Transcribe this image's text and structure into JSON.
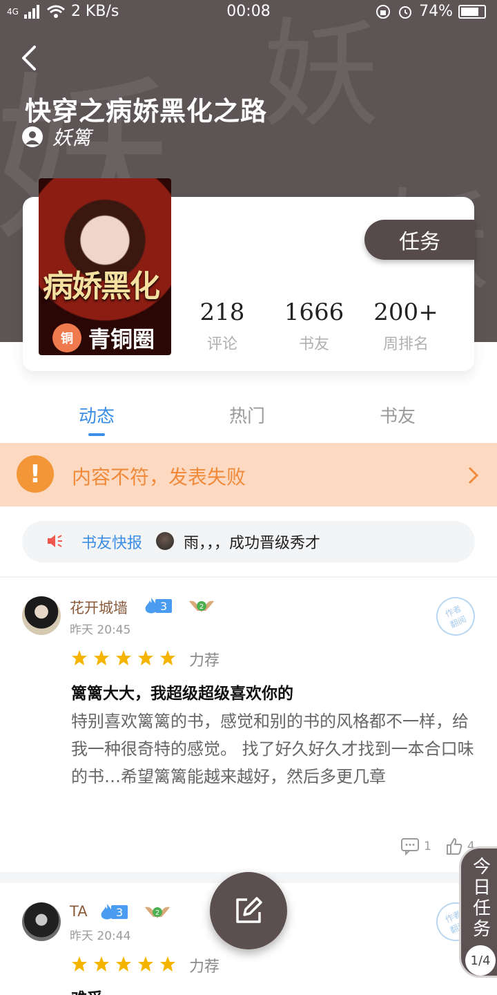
{
  "status_bar": {
    "network": "4G",
    "speed": "2 KB/s",
    "time": "00:08",
    "battery": "74%"
  },
  "header": {
    "watermark_char": "妖",
    "title": "快穿之病娇黑化之路",
    "author": "妖篱"
  },
  "cover": {
    "title_art": "病娇黑化",
    "badge_icon": "铜",
    "badge_text": "青铜圈"
  },
  "task_button": "任务",
  "stats": [
    {
      "value": "218",
      "label": "评论"
    },
    {
      "value": "1666",
      "label": "书友"
    },
    {
      "value": "200+",
      "label": "周排名"
    }
  ],
  "tabs": [
    {
      "label": "动态",
      "active": true
    },
    {
      "label": "热门",
      "active": false
    },
    {
      "label": "书友",
      "active": false
    }
  ],
  "error_banner": {
    "icon": "!",
    "text": "内容不符，发表失败"
  },
  "news": {
    "label": "书友快报",
    "text": "雨，，，成功晋级秀才"
  },
  "posts": [
    {
      "username": "花开城墙",
      "level": "3",
      "badge_level": "2",
      "time": "昨天 20:45",
      "stamp": "作者\n翻阅",
      "rating_label": "力荐",
      "stars": 5,
      "title": "篱篱大大，我超级超级喜欢你的",
      "body": "特别喜欢篱篱的书，感觉和别的书的风格都不一样，给我一种很奇特的感觉。 找了好久好久才找到一本合口味的书…希望篱篱能越来越好，然后多更几章",
      "comments": "1",
      "likes": "4"
    },
    {
      "username": "TA",
      "level": "3",
      "badge_level": "2",
      "time": "昨天 20:44",
      "stamp": "作者\n翻阅",
      "rating_label": "力荐",
      "stars": 5,
      "title": "难受"
    }
  ],
  "daily_task": {
    "label": "今日任务",
    "progress": "1/4"
  },
  "colors": {
    "header_bg": "#5d5455",
    "accent_blue": "#3a8ee6",
    "banner_bg": "#fdd9c1",
    "banner_text": "#f08a3a",
    "star": "#f5b400"
  }
}
